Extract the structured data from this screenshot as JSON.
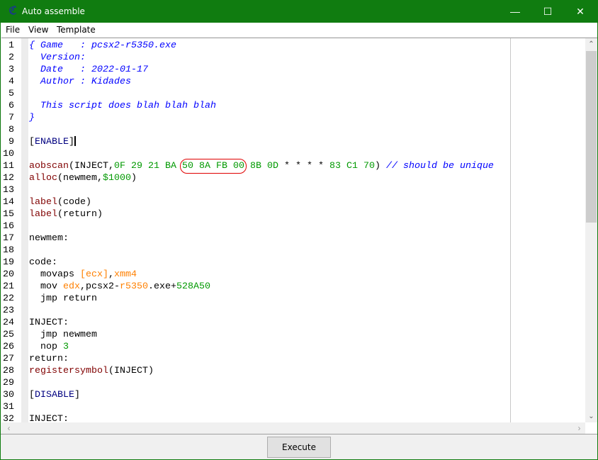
{
  "window": {
    "title": "Auto assemble",
    "accent": "#107c10",
    "icon": "cheat-engine-icon",
    "controls": [
      "minimize",
      "maximize",
      "close"
    ]
  },
  "menu": [
    "File",
    "View",
    "Template"
  ],
  "editor": {
    "lines": [
      [
        [
          "{ Game   : pcsx2-r5350.exe",
          "cm"
        ]
      ],
      [
        [
          "  Version:",
          "cm"
        ]
      ],
      [
        [
          "  Date   : 2022-01-17",
          "cm"
        ]
      ],
      [
        [
          "  Author : Kidades",
          "cm"
        ]
      ],
      [],
      [
        [
          "  This script does blah blah blah",
          "cm"
        ]
      ],
      [
        [
          "}",
          "cm"
        ]
      ],
      [],
      [
        [
          "[",
          ""
        ],
        [
          "ENABLE",
          "sec"
        ],
        [
          "]",
          ""
        ]
      ],
      [],
      [
        [
          "aobscan",
          "kw"
        ],
        [
          "(INJECT,",
          ""
        ],
        [
          "0F 29 21 BA ",
          "num"
        ],
        [
          "50 8A FB 00",
          "num hl"
        ],
        [
          " 8B 0D ",
          "num"
        ],
        [
          "* * * * ",
          ""
        ],
        [
          "83 C1 70",
          "num"
        ],
        [
          ") ",
          ""
        ],
        [
          "// should be unique",
          "cm"
        ]
      ],
      [
        [
          "alloc",
          "kw"
        ],
        [
          "(newmem,",
          ""
        ],
        [
          "$1000",
          "num"
        ],
        [
          ")",
          ""
        ]
      ],
      [],
      [
        [
          "label",
          "kw"
        ],
        [
          "(code)",
          ""
        ]
      ],
      [
        [
          "label",
          "kw"
        ],
        [
          "(return)",
          ""
        ]
      ],
      [],
      [
        [
          "newmem:",
          ""
        ]
      ],
      [],
      [
        [
          "code:",
          ""
        ]
      ],
      [
        [
          "  movaps ",
          ""
        ],
        [
          "[ecx]",
          "reg"
        ],
        [
          ",",
          ""
        ],
        [
          "xmm4",
          "reg"
        ]
      ],
      [
        [
          "  mov ",
          ""
        ],
        [
          "edx",
          "reg"
        ],
        [
          ",pcsx2-",
          ""
        ],
        [
          "r5350",
          "reg"
        ],
        [
          ".exe+",
          ""
        ],
        [
          "528A50",
          "num"
        ]
      ],
      [
        [
          "  jmp return",
          ""
        ]
      ],
      [],
      [
        [
          "INJECT:",
          ""
        ]
      ],
      [
        [
          "  jmp newmem",
          ""
        ]
      ],
      [
        [
          "  nop ",
          ""
        ],
        [
          "3",
          "num"
        ]
      ],
      [
        [
          "return:",
          ""
        ]
      ],
      [
        [
          "registersymbol",
          "kw"
        ],
        [
          "(INJECT)",
          ""
        ]
      ],
      [],
      [
        [
          "[",
          ""
        ],
        [
          "DISABLE",
          "sec"
        ],
        [
          "]",
          ""
        ]
      ],
      [],
      [
        [
          "INJECT:",
          ""
        ]
      ]
    ],
    "caret_line": 9,
    "vertical_scroll_fraction": 0
  },
  "buttons": {
    "execute": "Execute"
  }
}
